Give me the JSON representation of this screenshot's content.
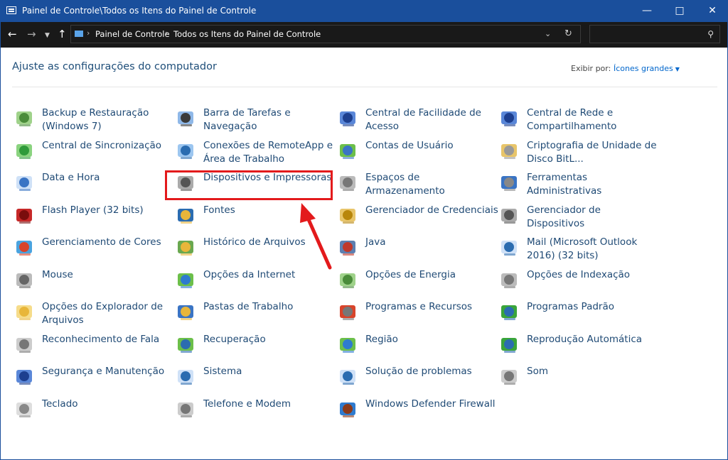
{
  "window": {
    "title": "Painel de Controle\\Todos os Itens do Painel de Controle"
  },
  "address": {
    "crumb1": "Painel de Controle",
    "crumb2": "Todos os Itens do Painel de Controle",
    "search_placeholder": ""
  },
  "header": {
    "heading": "Ajuste as configurações do computador",
    "view_by_label": "Exibir por:",
    "view_by_value": "Ícones grandes"
  },
  "items": [
    {
      "label": "Backup e Restauração (Windows 7)",
      "icon": "backup-icon"
    },
    {
      "label": "Central de Sincronização",
      "icon": "sync-icon"
    },
    {
      "label": "Data e Hora",
      "icon": "clock-icon"
    },
    {
      "label": "Flash Player (32 bits)",
      "icon": "flash-icon"
    },
    {
      "label": "Gerenciamento de Cores",
      "icon": "color-management-icon"
    },
    {
      "label": "Mouse",
      "icon": "mouse-icon"
    },
    {
      "label": "Opções do Explorador de Arquivos",
      "icon": "folder-options-icon"
    },
    {
      "label": "Reconhecimento de Fala",
      "icon": "microphone-icon"
    },
    {
      "label": "Segurança e Manutenção",
      "icon": "flag-icon"
    },
    {
      "label": "Teclado",
      "icon": "keyboard-icon"
    },
    {
      "label": "Barra de Tarefas e Navegação",
      "icon": "taskbar-icon"
    },
    {
      "label": "Conexões de RemoteApp e Área de Trabalho",
      "icon": "remoteapp-icon"
    },
    {
      "label": "Dispositivos e Impressoras",
      "icon": "printer-icon"
    },
    {
      "label": "Fontes",
      "icon": "fonts-icon"
    },
    {
      "label": "Histórico de Arquivos",
      "icon": "file-history-icon"
    },
    {
      "label": "Opções da Internet",
      "icon": "internet-options-icon"
    },
    {
      "label": "Pastas de Trabalho",
      "icon": "work-folders-icon"
    },
    {
      "label": "Recuperação",
      "icon": "recovery-icon"
    },
    {
      "label": "Sistema",
      "icon": "system-icon"
    },
    {
      "label": "Telefone e Modem",
      "icon": "phone-icon"
    },
    {
      "label": "Central de Facilidade de Acesso",
      "icon": "ease-of-access-icon"
    },
    {
      "label": "Contas de Usuário",
      "icon": "users-icon"
    },
    {
      "label": "Espaços de Armazenamento",
      "icon": "storage-icon"
    },
    {
      "label": "Gerenciador de Credenciais",
      "icon": "credentials-icon"
    },
    {
      "label": "Java",
      "icon": "java-icon"
    },
    {
      "label": "Opções de Energia",
      "icon": "power-icon"
    },
    {
      "label": "Programas e Recursos",
      "icon": "programs-icon"
    },
    {
      "label": "Região",
      "icon": "globe-icon"
    },
    {
      "label": "Solução de problemas",
      "icon": "troubleshoot-icon"
    },
    {
      "label": "Windows Defender Firewall",
      "icon": "firewall-icon"
    },
    {
      "label": "Central de Rede e Compartilhamento",
      "icon": "network-icon"
    },
    {
      "label": "Criptografia de Unidade de Disco BitL...",
      "icon": "bitlocker-icon"
    },
    {
      "label": "Ferramentas Administrativas",
      "icon": "admin-tools-icon"
    },
    {
      "label": "Gerenciador de Dispositivos",
      "icon": "device-manager-icon"
    },
    {
      "label": "Mail (Microsoft Outlook 2016) (32 bits)",
      "icon": "mail-icon"
    },
    {
      "label": "Opções de Indexação",
      "icon": "indexing-icon"
    },
    {
      "label": "Programas Padrão",
      "icon": "default-programs-icon"
    },
    {
      "label": "Reprodução Automática",
      "icon": "autoplay-icon"
    },
    {
      "label": "Som",
      "icon": "speaker-icon"
    }
  ],
  "colors": {
    "titlebar": "#1a4f9c",
    "addressbar": "#191919",
    "link": "#1f4a75",
    "highlight": "#e31a1c"
  }
}
